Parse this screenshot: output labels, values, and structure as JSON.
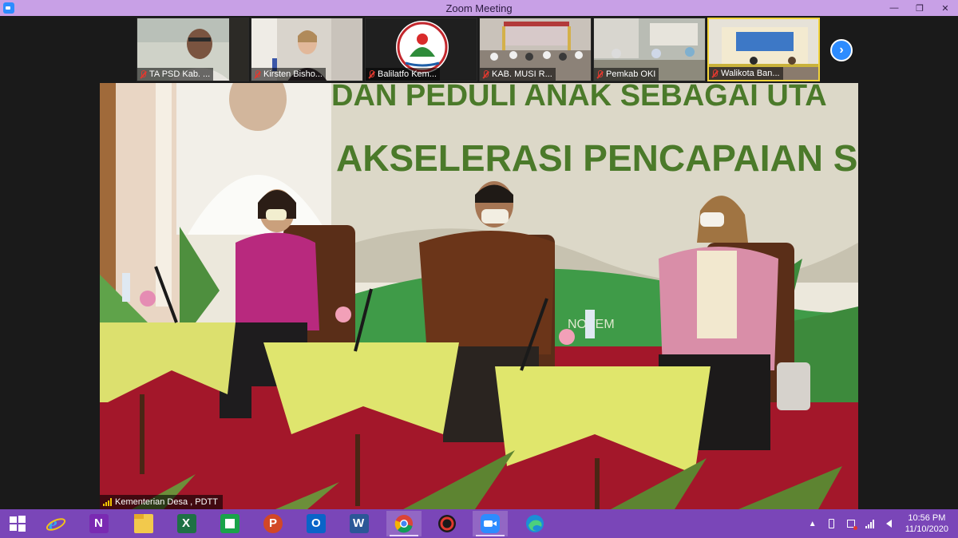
{
  "window": {
    "title": "Zoom Meeting",
    "controls": {
      "minimize": "—",
      "restore": "❐",
      "close": "✕"
    }
  },
  "participants": [
    {
      "name": "TA PSD Kab. ...",
      "muted": true
    },
    {
      "name": "Kirsten Bisho...",
      "muted": true
    },
    {
      "name": "Balilatfo Kem...",
      "muted": true
    },
    {
      "name": "KAB. MUSI R...",
      "muted": true
    },
    {
      "name": "Pemkab OKI",
      "muted": true
    },
    {
      "name": "Walikota Ban...",
      "muted": true
    }
  ],
  "next_page_icon": "chevron-right-icon",
  "main_video": {
    "speaker": "Kementerian Desa , PDTT",
    "banner_line1": "DAN PEDULI ANAK SEBAGAI UTA",
    "banner_line2": "AKSELERASI PENCAPAIAN SDGs",
    "backdrop_text": "NOVEM"
  },
  "taskbar": {
    "apps": [
      {
        "name": "start",
        "icon": "windows-logo-icon"
      },
      {
        "name": "internet-explorer",
        "icon": "ie-icon"
      },
      {
        "name": "onenote",
        "icon": "onenote-icon"
      },
      {
        "name": "file-explorer",
        "icon": "folder-icon"
      },
      {
        "name": "excel",
        "icon": "excel-icon"
      },
      {
        "name": "store",
        "icon": "store-icon"
      },
      {
        "name": "powerpoint",
        "icon": "powerpoint-icon"
      },
      {
        "name": "outlook",
        "icon": "outlook-icon"
      },
      {
        "name": "word",
        "icon": "word-icon"
      },
      {
        "name": "chrome",
        "icon": "chrome-icon"
      },
      {
        "name": "app-red",
        "icon": "circle-app-icon"
      },
      {
        "name": "zoom",
        "icon": "zoom-icon"
      },
      {
        "name": "edge",
        "icon": "edge-icon"
      }
    ],
    "time": "10:56 PM",
    "date": "11/10/2020"
  },
  "colors": {
    "titlebar": "#c8a0e6",
    "taskbar": "#7a46b8",
    "zoom_blue": "#2d8cff",
    "active_speaker": "#f2d43a",
    "banner_text": "#4b7a2a"
  }
}
